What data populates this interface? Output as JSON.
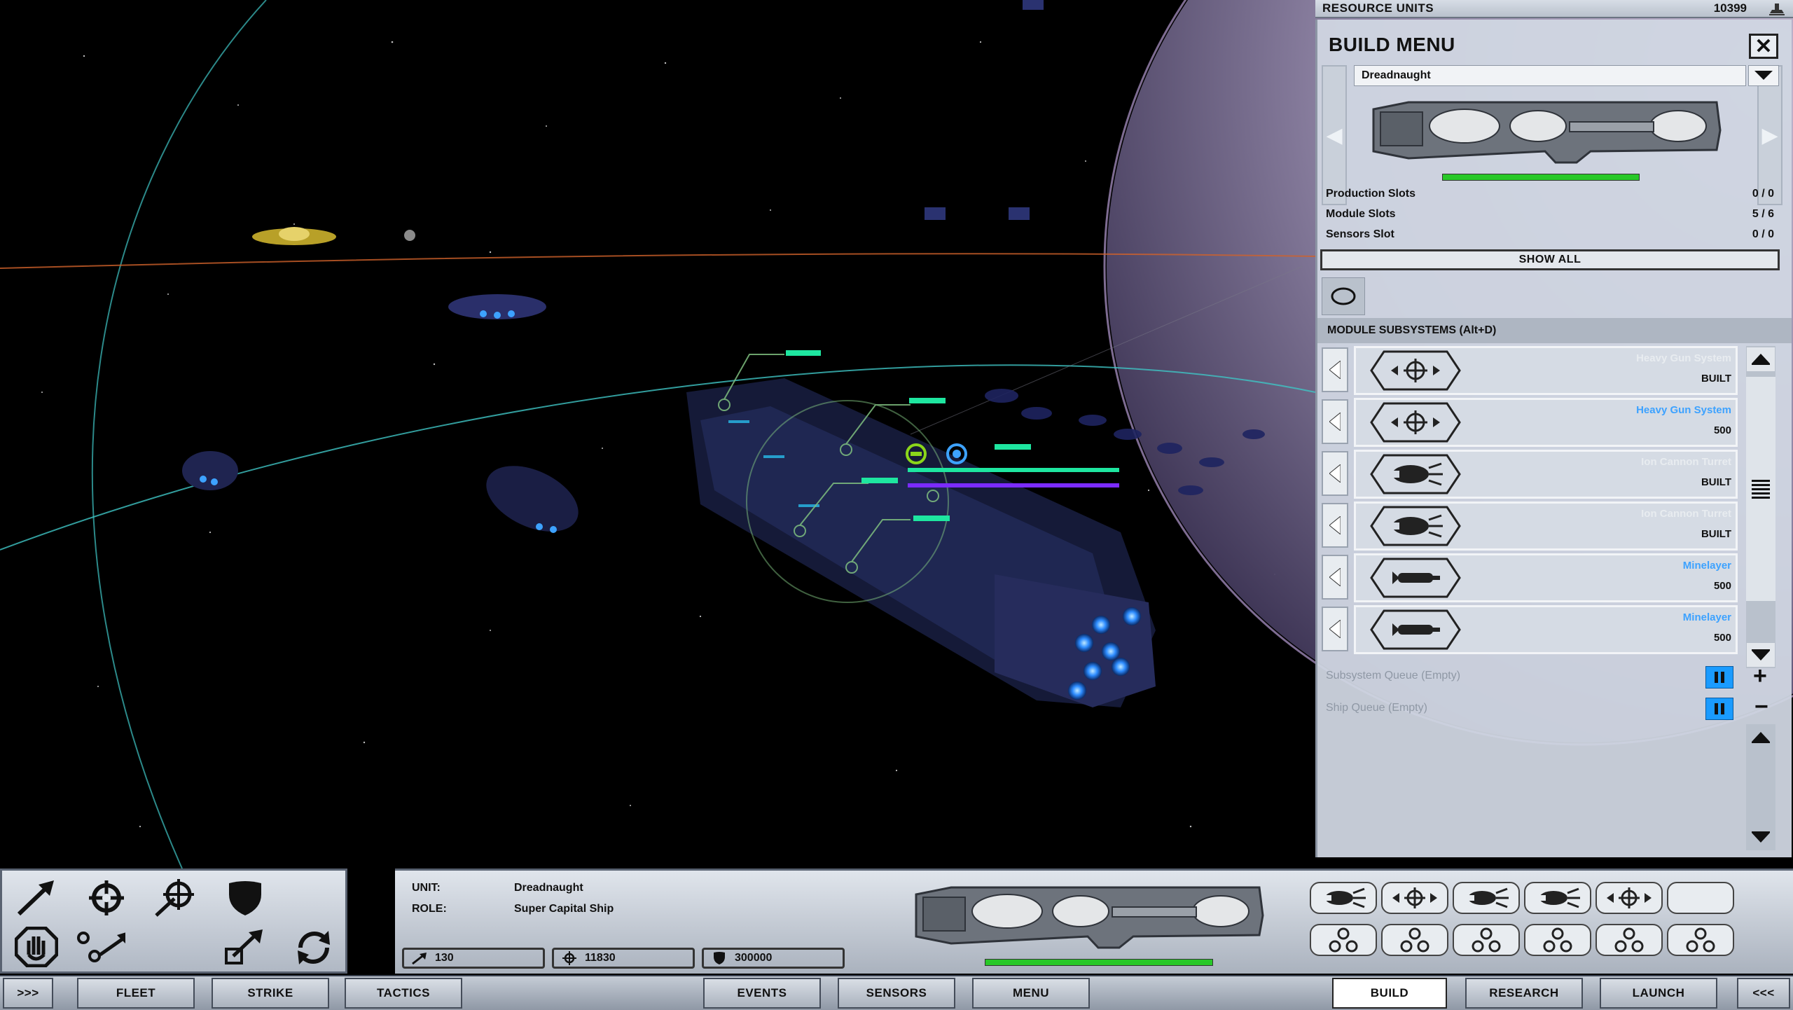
{
  "resources": {
    "label": "RESOURCE UNITS",
    "value": "10399"
  },
  "build_menu": {
    "title": "BUILD MENU",
    "selected_ship": "Dreadnaught",
    "health_fraction": 1.0,
    "stats": [
      {
        "label": "Production Slots",
        "value": "0 / 0"
      },
      {
        "label": "Module Slots",
        "value": "5 / 6"
      },
      {
        "label": "Sensors Slot",
        "value": "0 / 0"
      }
    ],
    "show_all_label": "SHOW ALL",
    "section_title": "MODULE SUBSYSTEMS (Alt+D)",
    "modules": [
      {
        "name": "Heavy Gun System",
        "status": "BUILT",
        "icon": "heavy-gun-icon",
        "available": false
      },
      {
        "name": "Heavy Gun System",
        "status": "500",
        "icon": "heavy-gun-icon",
        "available": true
      },
      {
        "name": "Ion Cannon Turret",
        "status": "BUILT",
        "icon": "ion-cannon-icon",
        "available": false
      },
      {
        "name": "Ion Cannon Turret",
        "status": "BUILT",
        "icon": "ion-cannon-icon",
        "available": false
      },
      {
        "name": "Minelayer",
        "status": "500",
        "icon": "minelayer-icon",
        "available": true
      },
      {
        "name": "Minelayer",
        "status": "500",
        "icon": "minelayer-icon",
        "available": true
      }
    ],
    "subsystem_queue": "Subsystem Queue (Empty)",
    "ship_queue": "Ship Queue (Empty)"
  },
  "unit_info": {
    "unit_label": "UNIT:",
    "unit_value": "Dreadnaught",
    "role_label": "ROLE:",
    "role_value": "Super Capital Ship",
    "speed": "130",
    "firepower": "11830",
    "armor": "300000",
    "health_fraction": 1.0
  },
  "subsystem_slots": [
    "ion-cannon-icon",
    "heavy-gun-icon",
    "ion-cannon-icon",
    "ion-cannon-icon",
    "heavy-gun-icon",
    "empty-slot",
    "cluster-icon",
    "cluster-icon",
    "cluster-icon",
    "cluster-icon",
    "cluster-icon",
    "cluster-icon"
  ],
  "tabs": {
    "expand": ">>>",
    "fleet": "FLEET",
    "strike": "STRIKE",
    "tactics": "TACTICS",
    "events": "EVENTS",
    "sensors": "SENSORS",
    "menu": "MENU",
    "build": "BUILD",
    "research": "RESEARCH",
    "launch": "LAUNCH",
    "collapse": "<<<"
  },
  "colors": {
    "accent_blue": "#3da2ff",
    "health_green": "#28c828",
    "target_green": "#1ee6a0",
    "orbit_cyan": "#3fc4c4"
  }
}
